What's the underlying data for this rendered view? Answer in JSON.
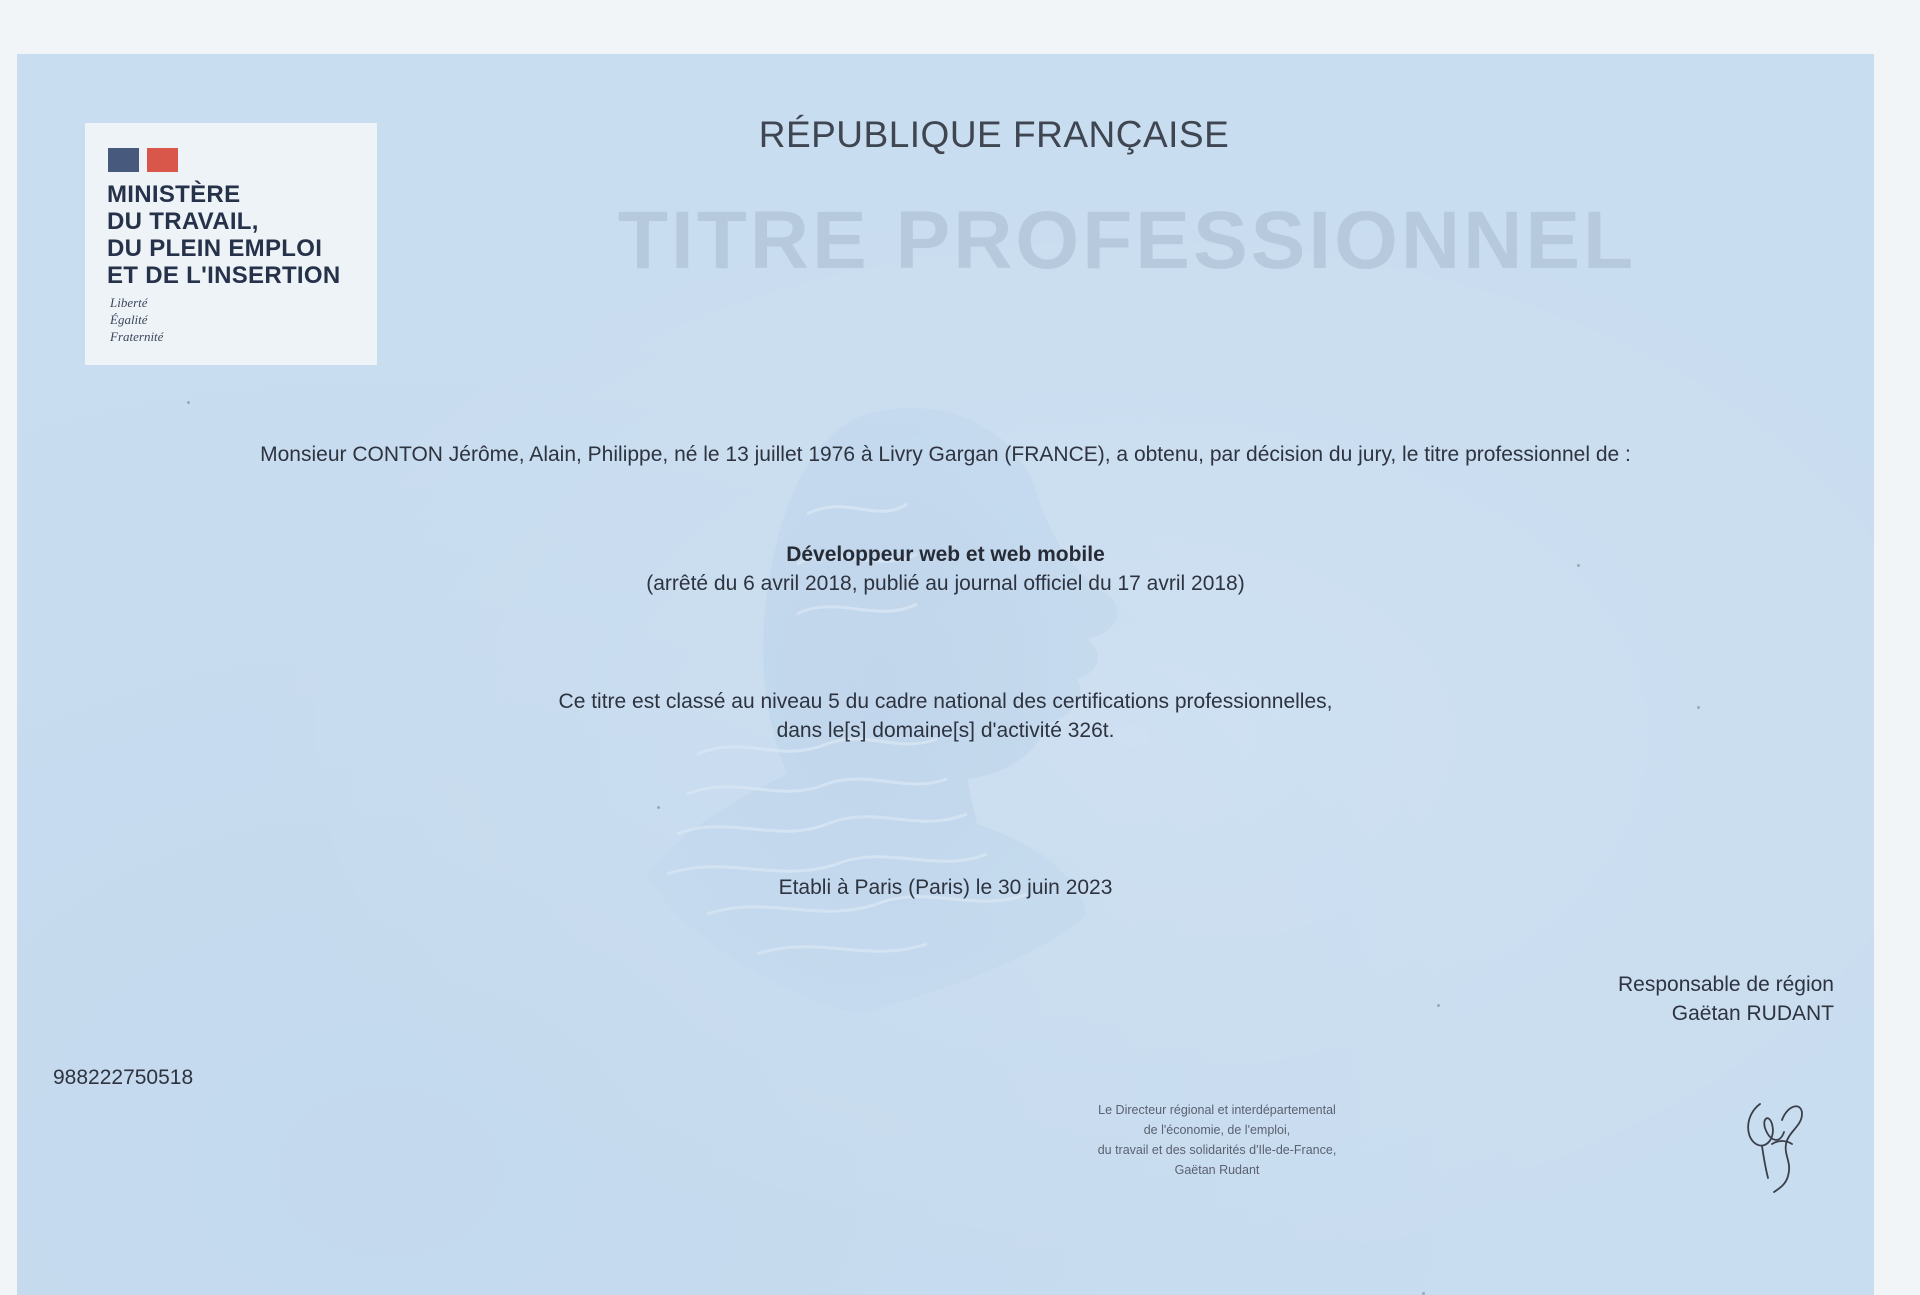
{
  "logo": {
    "ministry_lines": [
      "MINISTÈRE",
      "DU TRAVAIL,",
      "DU PLEIN EMPLOI",
      "ET DE L'INSERTION"
    ],
    "motto_lines": [
      "Liberté",
      "Égalité",
      "Fraternité"
    ]
  },
  "header": {
    "republic": "RÉPUBLIQUE FRANÇAISE",
    "title": "TITRE PROFESSIONNEL"
  },
  "body": {
    "award_text": "Monsieur CONTON Jérôme, Alain, Philippe, né le 13 juillet 1976 à Livry Gargan (FRANCE), a obtenu, par décision du jury, le titre professionnel de :",
    "qualification_title": "Développeur web et web mobile",
    "qualification_decree": "(arrêté du 6 avril 2018, publié au journal officiel du 17 avril 2018)",
    "level_line1": "Ce titre est classé au niveau 5 du cadre national des certifications professionnelles,",
    "level_line2": "dans le[s] domaine[s] d'activité 326t.",
    "issued": "Etabli à Paris (Paris) le 30 juin 2023"
  },
  "signature_block": {
    "role": "Responsable de région",
    "name": "Gaëtan RUDANT",
    "stamp_lines": [
      "Le Directeur régional et interdépartemental",
      "de l'économie, de l'emploi,",
      "du travail et des solidarités d'Ile-de-France,",
      "Gaëtan Rudant"
    ]
  },
  "certificate_number": "988222750518",
  "colors": {
    "paper": "#c9ddf0",
    "flag_blue": "#47597c",
    "flag_red": "#d8574a",
    "title_watermark": "#b6c9dd"
  }
}
